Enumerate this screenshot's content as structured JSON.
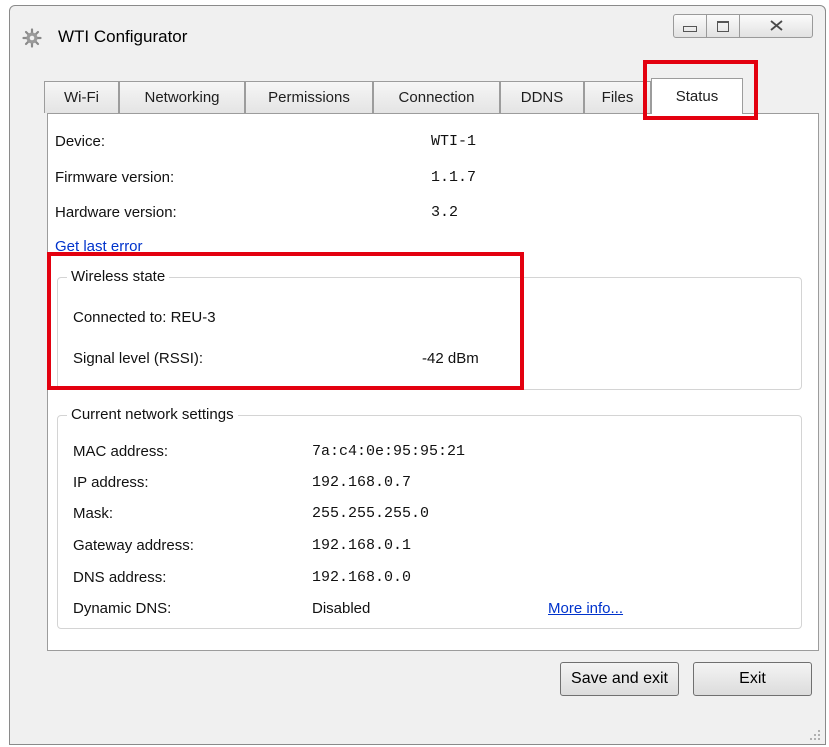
{
  "window": {
    "title": "WTI Configurator",
    "icons": {
      "app": "gear-icon",
      "minimize": "minimize-icon",
      "maximize": "maximize-icon",
      "close": "close-icon"
    }
  },
  "tabs": [
    {
      "label": "Wi-Fi"
    },
    {
      "label": "Networking"
    },
    {
      "label": "Permissions"
    },
    {
      "label": "Connection"
    },
    {
      "label": "DDNS"
    },
    {
      "label": "Files"
    },
    {
      "label": "Status",
      "active": true
    }
  ],
  "status": {
    "device_label": "Device:",
    "device_value": "WTI-1",
    "firmware_label": "Firmware version:",
    "firmware_value": "1.1.7",
    "hardware_label": "Hardware version:",
    "hardware_value": "3.2",
    "get_last_error": "Get last error"
  },
  "wireless": {
    "title": "Wireless state",
    "connected": "Connected to: REU-3",
    "signal_label": "Signal level (RSSI):",
    "signal_value": "-42 dBm"
  },
  "network": {
    "title": "Current network settings",
    "mac_label": "MAC address:",
    "mac_value": "7a:c4:0e:95:95:21",
    "ip_label": "IP address:",
    "ip_value": "192.168.0.7",
    "mask_label": "Mask:",
    "mask_value": "255.255.255.0",
    "gateway_label": "Gateway address:",
    "gateway_value": "192.168.0.1",
    "dns_label": "DNS address:",
    "dns_value": "192.168.0.0",
    "ddns_label": "Dynamic DNS:",
    "ddns_value": "Disabled",
    "more_info": "More info..."
  },
  "buttons": {
    "save_exit": "Save and exit",
    "exit": "Exit"
  },
  "colors": {
    "highlight": "#e3000f",
    "link": "#0033cc"
  }
}
